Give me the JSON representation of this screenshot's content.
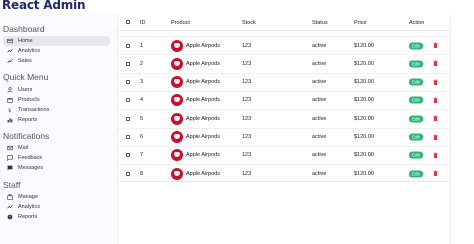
{
  "app": {
    "title": "React Admin"
  },
  "sidebar": {
    "sections": [
      {
        "title": "Dashboard",
        "items": [
          {
            "label": "Home",
            "icon": "home-icon",
            "active": true
          },
          {
            "label": "Analytics",
            "icon": "timeline-icon"
          },
          {
            "label": "Sales",
            "icon": "trending-up-icon"
          }
        ]
      },
      {
        "title": "Quick Menu",
        "items": [
          {
            "label": "Users",
            "icon": "user-icon"
          },
          {
            "label": "Products",
            "icon": "storefront-icon"
          },
          {
            "label": "Transactions",
            "icon": "money-icon"
          },
          {
            "label": "Reports",
            "icon": "bar-chart-icon"
          }
        ]
      },
      {
        "title": "Notifications",
        "items": [
          {
            "label": "Mail",
            "icon": "mail-icon"
          },
          {
            "label": "Feedback",
            "icon": "feedback-icon"
          },
          {
            "label": "Messages",
            "icon": "chat-icon"
          }
        ]
      },
      {
        "title": "Staff",
        "items": [
          {
            "label": "Manage",
            "icon": "work-icon"
          },
          {
            "label": "Analytics",
            "icon": "timeline-icon"
          },
          {
            "label": "Reports",
            "icon": "report-icon"
          }
        ]
      }
    ]
  },
  "table": {
    "columns": [
      "ID",
      "Product",
      "Stock",
      "Status",
      "Price",
      "Action"
    ],
    "rows": [
      {
        "id": "1",
        "product": "Apple Airpods",
        "stock": "123",
        "status": "active",
        "price": "$120.00"
      },
      {
        "id": "2",
        "product": "Apple Airpods",
        "stock": "123",
        "status": "active",
        "price": "$120.00"
      },
      {
        "id": "3",
        "product": "Apple Airpods",
        "stock": "123",
        "status": "active",
        "price": "$120.00"
      },
      {
        "id": "4",
        "product": "Apple Airpods",
        "stock": "123",
        "status": "active",
        "price": "$120.00"
      },
      {
        "id": "5",
        "product": "Apple Airpods",
        "stock": "123",
        "status": "active",
        "price": "$120.00"
      },
      {
        "id": "6",
        "product": "Apple Airpods",
        "stock": "123",
        "status": "active",
        "price": "$120.00"
      },
      {
        "id": "7",
        "product": "Apple Airpods",
        "stock": "123",
        "status": "active",
        "price": "$120.00"
      },
      {
        "id": "8",
        "product": "Apple Airpods",
        "stock": "123",
        "status": "active",
        "price": "$120.00"
      }
    ],
    "edit_label": "Edit"
  },
  "colors": {
    "brand": "#1f2a6b",
    "edit": "#2bb673",
    "delete": "#d9363e",
    "active_item": "#e6e6ec"
  }
}
